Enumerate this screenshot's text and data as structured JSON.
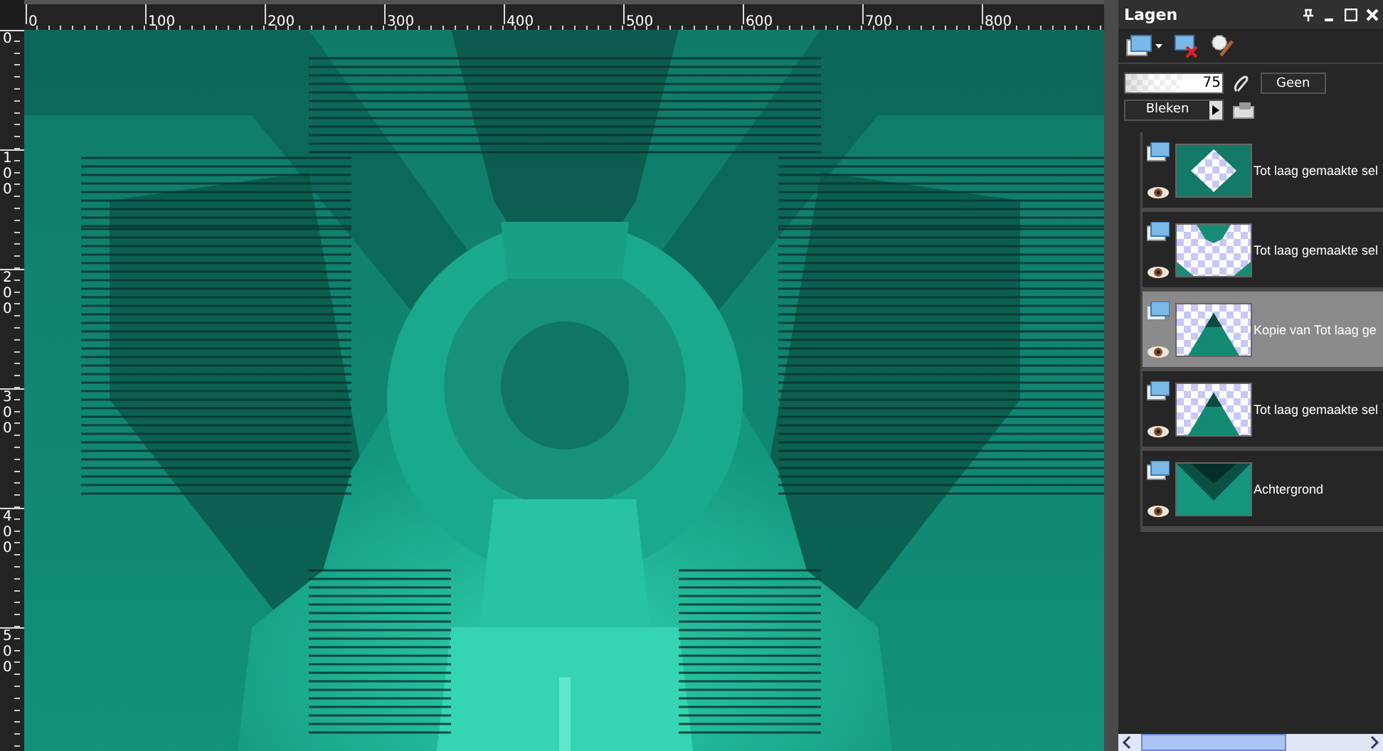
{
  "rulers": {
    "horizontal": [
      "0",
      "100",
      "200",
      "300",
      "400",
      "500",
      "600",
      "700",
      "800"
    ],
    "vertical": [
      "0",
      "100",
      "200",
      "300",
      "400",
      "500"
    ]
  },
  "layers_panel": {
    "title": "Lagen",
    "opacity": {
      "level": 0.75,
      "reading": "75"
    },
    "mask_button": "Geen",
    "blend_mode": "Bleken",
    "layers": [
      {
        "name": "Tot laag gemaakte sel",
        "kind": "diamond",
        "selected": false,
        "visible": true
      },
      {
        "name": "Tot laag gemaakte sel",
        "kind": "corners",
        "selected": false,
        "visible": true
      },
      {
        "name": "Kopie van Tot laag ge",
        "kind": "triangle",
        "selected": true,
        "visible": true
      },
      {
        "name": "Tot laag gemaakte sel",
        "kind": "triangle",
        "selected": false,
        "visible": true
      },
      {
        "name": "Achtergrond",
        "kind": "background",
        "selected": false,
        "visible": true
      }
    ]
  }
}
